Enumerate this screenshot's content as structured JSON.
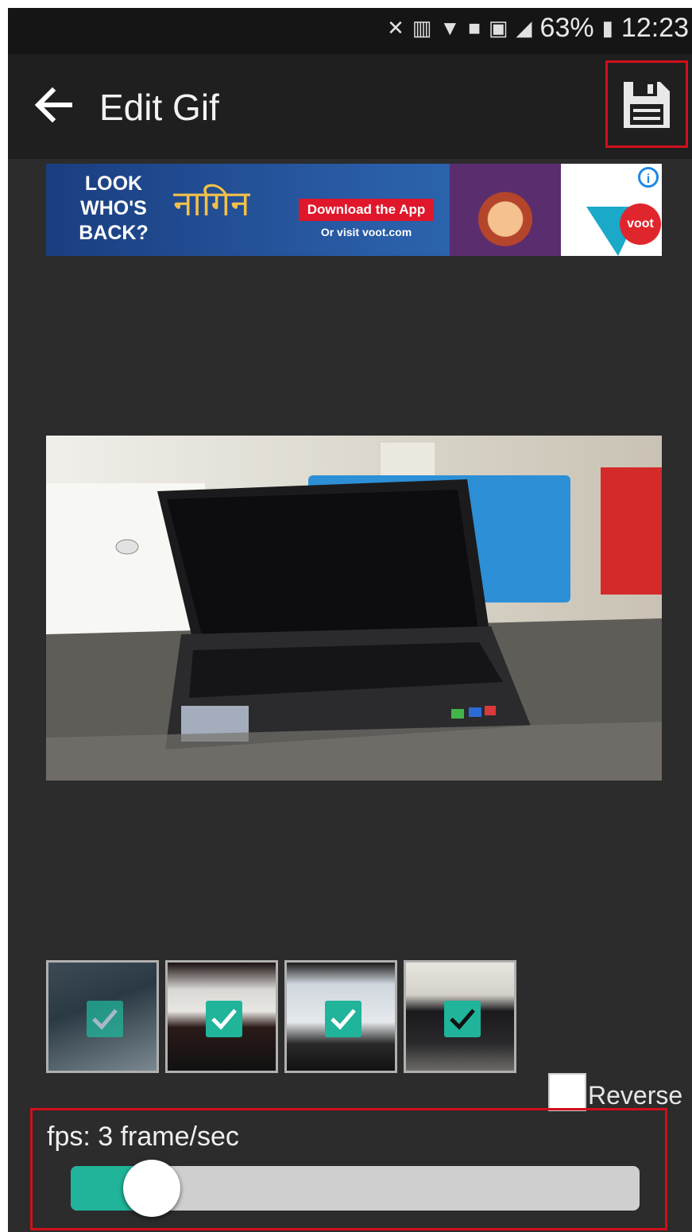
{
  "status_bar": {
    "battery": "63%",
    "time": "12:23",
    "icons": [
      "mute-vibrate-icon",
      "volte-icon",
      "wifi-icon",
      "notification-icon",
      "sim-icon",
      "signal-icon",
      "battery-icon"
    ]
  },
  "app_bar": {
    "title": "Edit Gif",
    "back_icon": "arrow-left-icon",
    "save_icon": "floppy-disk-icon"
  },
  "ad_banner": {
    "headline": "LOOK WHO'S BACK?",
    "show_logo": "नागिन",
    "cta": "Download the App",
    "sub": "Or visit voot.com",
    "brand": "voot"
  },
  "frames": {
    "count": 4,
    "selected": [
      true,
      true,
      true,
      true
    ]
  },
  "reverse": {
    "label": "Reverse",
    "checked": false
  },
  "fps": {
    "label": "fps: 3 frame/sec",
    "value": 3,
    "slider_fraction": 0.1
  },
  "colors": {
    "accent": "#20b49a",
    "highlight": "#d0101a",
    "background": "#2c2c2c"
  }
}
